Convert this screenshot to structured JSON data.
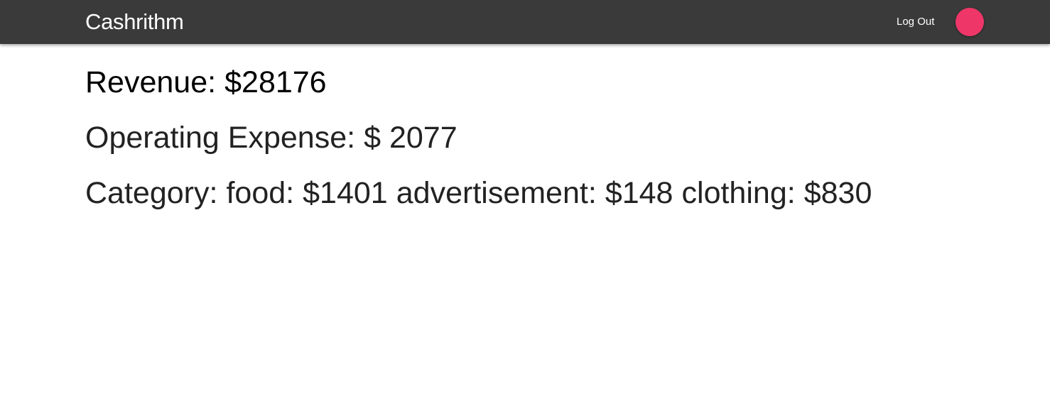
{
  "colors": {
    "navbar_bg": "#3a3a3a",
    "avatar": "#ef3669",
    "text": "#222222"
  },
  "navbar": {
    "brand": "Cashrithm",
    "logout_label": "Log Out",
    "avatar_icon": "avatar-circle"
  },
  "summary": {
    "revenue_label": "Revenue:",
    "revenue_value": "$28176",
    "expense_label": "Operating Expense:",
    "expense_value": "$ 2077",
    "category_label": "Category:",
    "categories": [
      {
        "name": "food:",
        "amount": "$1401"
      },
      {
        "name": "advertisement:",
        "amount": "$148"
      },
      {
        "name": "clothing:",
        "amount": "$830"
      }
    ]
  }
}
